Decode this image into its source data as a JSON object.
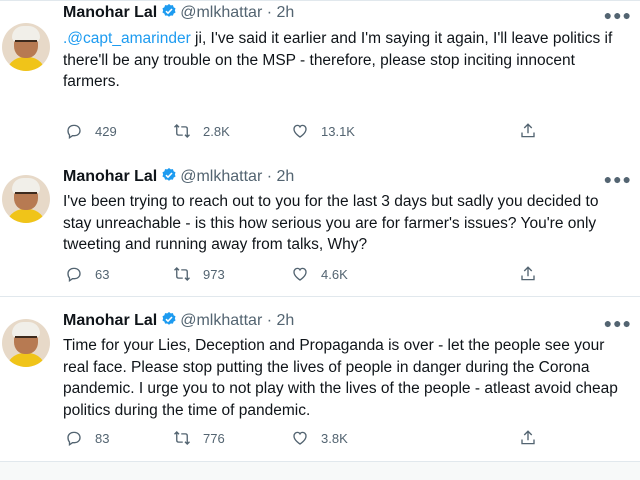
{
  "tweets": [
    {
      "name": "Manohar Lal",
      "handle": "@mlkhattar",
      "separator": "·",
      "time": "2h",
      "mention": ".@capt_amarinder",
      "text": " ji, I've said it earlier and I'm saying it again, I'll leave politics if there'll be any trouble on the MSP - therefore, please stop inciting innocent farmers.",
      "replies": "429",
      "retweets": "2.8K",
      "likes": "13.1K"
    },
    {
      "name": "Manohar Lal",
      "handle": "@mlkhattar",
      "separator": "·",
      "time": "2h",
      "text": "I've been trying to reach out to you for the last 3 days but sadly you decided to stay unreachable - is this how serious you are for farmer's issues? You're only tweeting and running away from talks, Why?",
      "replies": "63",
      "retweets": "973",
      "likes": "4.6K"
    },
    {
      "name": "Manohar Lal",
      "handle": "@mlkhattar",
      "separator": "·",
      "time": "2h",
      "text": "Time for your Lies, Deception and Propaganda is over - let the people see your real face. Please stop putting the lives of people in danger during the Corona pandemic. I urge you to not play with the lives of the people - atleast avoid cheap politics during the time of pandemic.",
      "replies": "83",
      "retweets": "776",
      "likes": "3.8K"
    }
  ],
  "colors": {
    "accent": "#1d9bf0",
    "text": "#0f1419",
    "secondary": "#536471"
  },
  "icons": [
    "verified-badge-icon",
    "more-icon",
    "reply-icon",
    "retweet-icon",
    "like-icon",
    "share-icon"
  ]
}
